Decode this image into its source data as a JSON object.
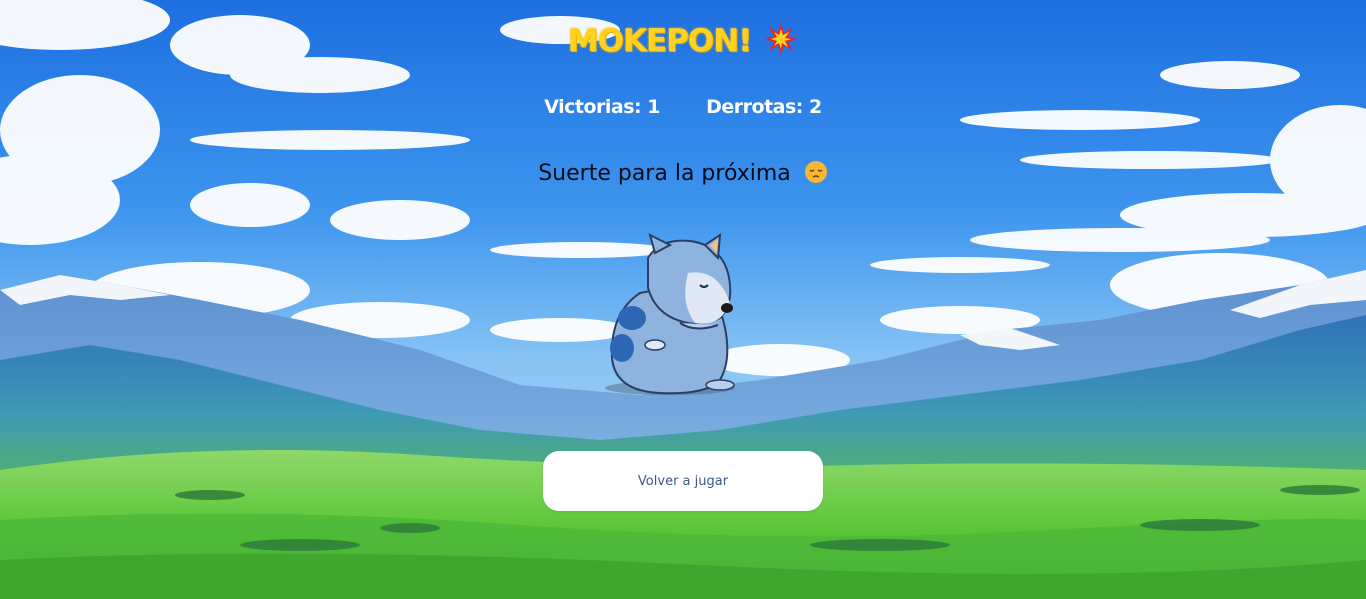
{
  "game": {
    "title": "MOKEPON!",
    "title_icon": "explosion-icon",
    "wins_label": "Victorias: 1",
    "losses_label": "Derrotas: 2",
    "result_message": "Suerte para la próxima",
    "result_icon": "pensive-face-icon",
    "mascot_icon": "blue-hamster-mokepon",
    "replay_button_label": "Volver a jugar"
  },
  "colors": {
    "title": "#ffd21f",
    "sky_top": "#1d6fe0",
    "grass": "#5ec83a",
    "button_text": "#3b5a8a"
  }
}
